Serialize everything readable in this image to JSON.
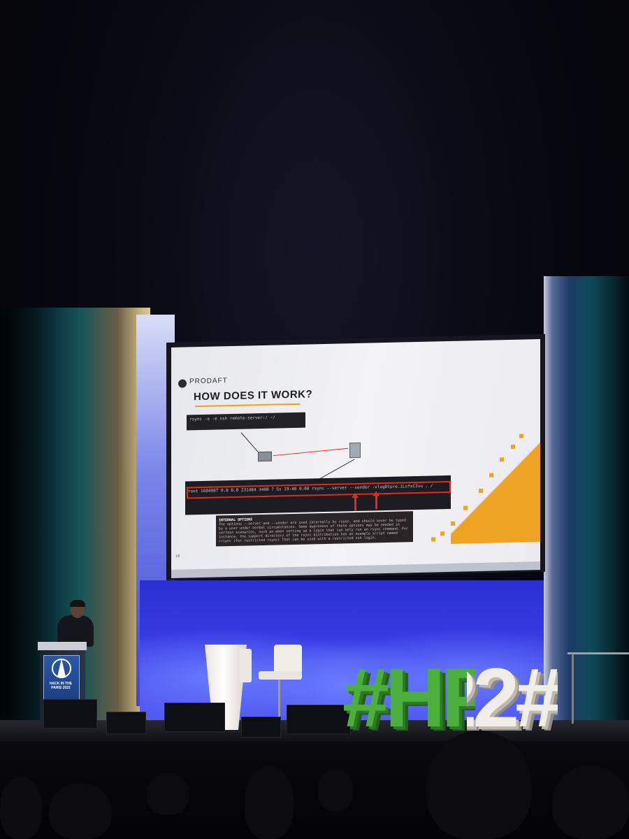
{
  "scene": {
    "event_sign": "#HP22"
  },
  "slide": {
    "brand": "PRODAFT",
    "title": "HOW DOES IT WORK?",
    "command_top": "rsync -a -e ssh remote-server:/ ~/",
    "process_line": "root   1604987  0.0  0.0 231404  3408 ?        Ss   19:40   0:00 rsync --server --sender -vlogDtpre.iLsfxCIvu . /",
    "internal_options_heading": "INTERNAL OPTIONS",
    "internal_options_body": "The options --server and --sender are used internally by rsync, and should never be typed by a user under normal circumstances. Some awareness of these options may be needed in certain scenarios, such as when setting up a login that can only run an rsync command. For instance, the support directory of the rsync distribution has an example script named rrsync (for restricted rsync) that can be used with a restricted ssh login.",
    "page_number": "18"
  },
  "podium": {
    "logo_text": "HACK IN THE PARIS 2022"
  }
}
